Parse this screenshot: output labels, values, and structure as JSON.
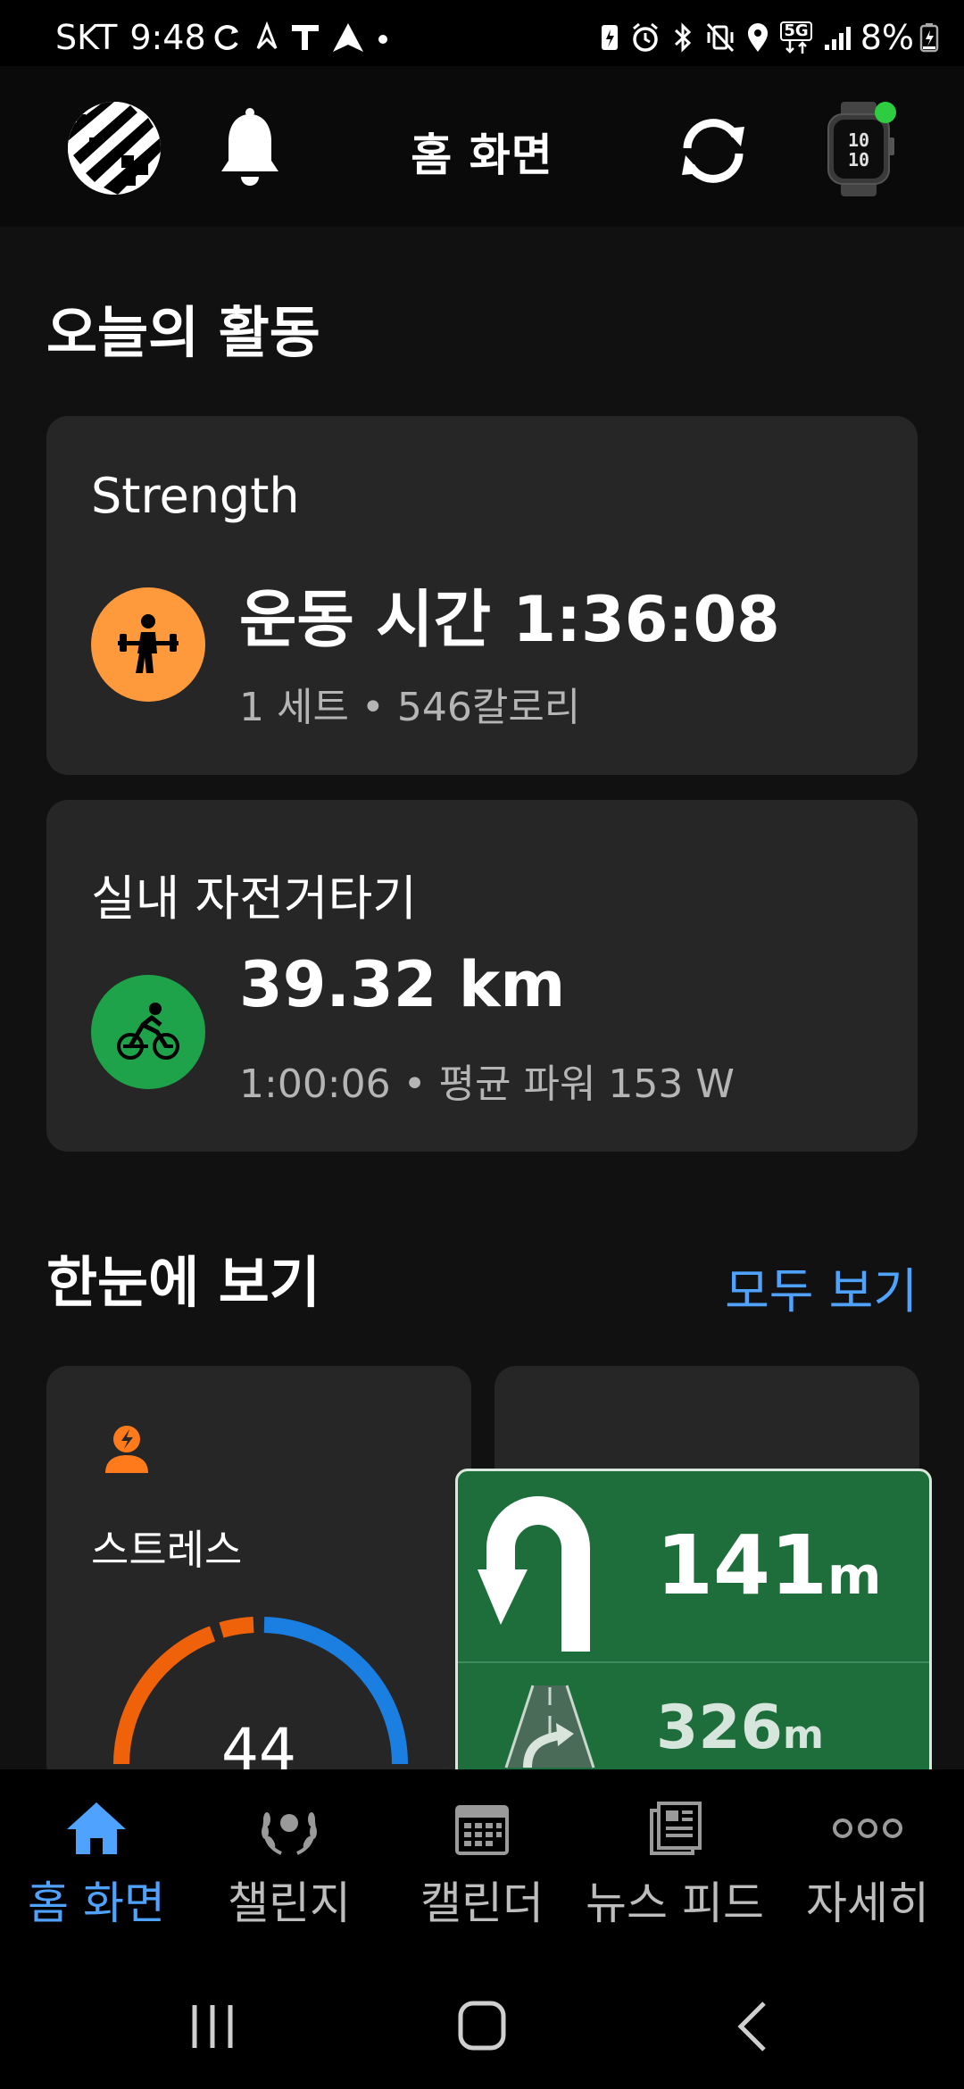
{
  "status_bar": {
    "carrier": "SKT",
    "time": "9:48",
    "network": "5G",
    "battery": "8%"
  },
  "header": {
    "title": "홈 화면"
  },
  "today": {
    "section_title": "오늘의 활동",
    "activities": [
      {
        "title": "Strength",
        "main": "운동 시간 1:36:08",
        "sub": "1 세트 • 546칼로리",
        "icon": "weightlifting-icon",
        "icon_color": "#ff9a3c"
      },
      {
        "title": "실내 자전거타기",
        "main": "39.32 km",
        "sub": "1:00:06 • 평균 파워 153 W",
        "icon": "cycling-icon",
        "icon_color": "#1fa34a"
      }
    ]
  },
  "glance": {
    "section_title": "한눈에 보기",
    "view_all": "모두 보기",
    "stress": {
      "label": "스트레스",
      "value": "44",
      "icon": "stress-icon",
      "icon_color": "#ff7a1a"
    }
  },
  "navigation_overlay": {
    "primary_distance": "141",
    "primary_unit": "m",
    "secondary_distance": "326",
    "secondary_unit": "m",
    "primary_icon": "u-turn-icon",
    "secondary_icon": "road-merge-icon",
    "background_color": "#1e6e3c"
  },
  "bottom_nav": {
    "items": [
      {
        "label": "홈 화면",
        "icon": "home-icon",
        "active": true
      },
      {
        "label": "챌린지",
        "icon": "laurel-icon",
        "active": false
      },
      {
        "label": "캘린더",
        "icon": "calendar-icon",
        "active": false
      },
      {
        "label": "뉴스 피드",
        "icon": "newsfeed-icon",
        "active": false
      },
      {
        "label": "자세히",
        "icon": "more-icon",
        "active": false
      }
    ],
    "active_color": "#4fa3ff"
  }
}
